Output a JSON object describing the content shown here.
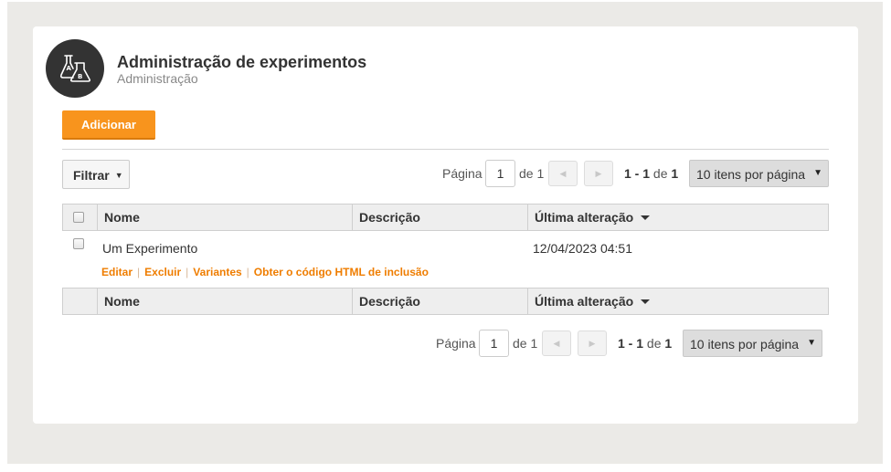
{
  "header": {
    "title": "Administração de experimentos",
    "subtitle": "Administração"
  },
  "toolbar": {
    "add_label": "Adicionar",
    "filter_label": "Filtrar"
  },
  "pagination": {
    "page_label": "Página",
    "page_value": "1",
    "of_label": "de 1",
    "range_start_end": "1 - 1",
    "range_of": "de",
    "range_total": "1",
    "per_page": "10 itens por página"
  },
  "table": {
    "columns": [
      "Nome",
      "Descrição",
      "Última alteração"
    ],
    "rows": [
      {
        "name": "Um Experimento",
        "description": "",
        "modified": "12/04/2023 04:51",
        "actions": [
          "Editar",
          "Excluir",
          "Variantes",
          "Obter o código HTML de inclusão"
        ]
      }
    ]
  },
  "colors": {
    "accent": "#f8941d",
    "link": "#ef7d00",
    "logo_bg": "#333333"
  },
  "icons": {
    "logo": "flask-ab-icon",
    "prev": "triangle-left-icon",
    "next": "triangle-right-icon",
    "sort": "caret-down-icon"
  }
}
